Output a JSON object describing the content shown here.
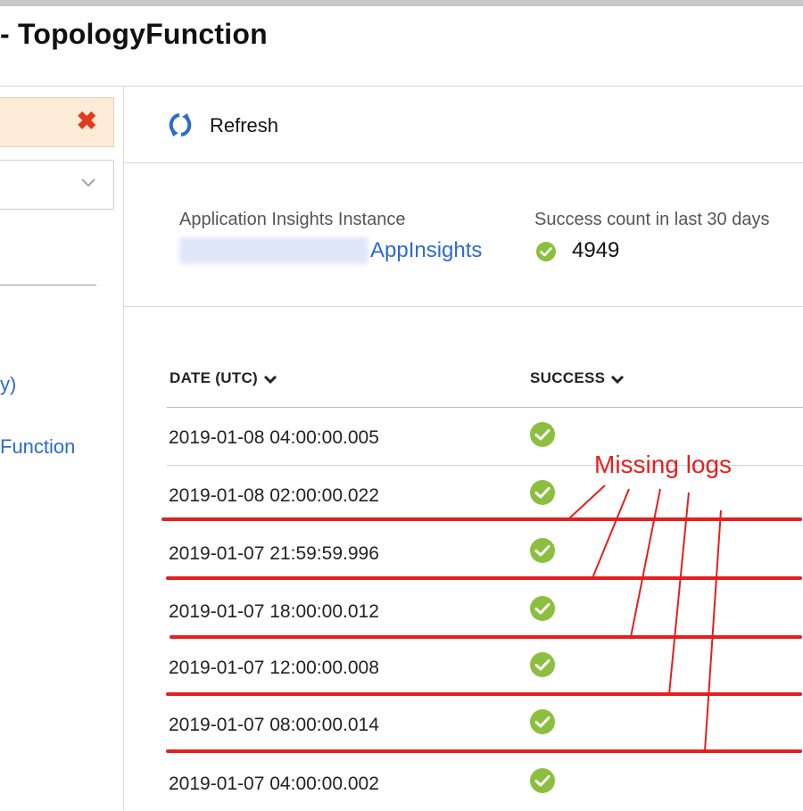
{
  "page": {
    "title": "- TopologyFunction"
  },
  "left_pane": {
    "links": [
      "y)",
      "Function"
    ]
  },
  "toolbar": {
    "refresh_label": "Refresh",
    "refresh_icon": "refresh-icon"
  },
  "info": {
    "instance_label": "Application Insights Instance",
    "instance_link": "AppInsights",
    "success_label": "Success count in last 30 days",
    "success_count": "4949"
  },
  "table": {
    "columns": [
      "DATE (UTC)",
      "SUCCESS"
    ],
    "rows": [
      {
        "date": "2019-01-08 04:00:00.005",
        "success": "check-circle-icon"
      },
      {
        "date": "2019-01-08 02:00:00.022",
        "success": "check-circle-icon"
      },
      {
        "date": "2019-01-07 21:59:59.996",
        "success": "check-circle-icon"
      },
      {
        "date": "2019-01-07 18:00:00.012",
        "success": "check-circle-icon"
      },
      {
        "date": "2019-01-07 12:00:00.008",
        "success": "check-circle-icon"
      },
      {
        "date": "2019-01-07 08:00:00.014",
        "success": "check-circle-icon"
      },
      {
        "date": "2019-01-07 04:00:00.002",
        "success": "check-circle-icon"
      }
    ]
  },
  "annotation": {
    "text": "Missing logs",
    "color": "#e61e1e"
  },
  "colors": {
    "link": "#2d6ad1",
    "success_green": "#8cbf3f",
    "error_red": "#e33a1f",
    "filter_bg": "#fbebd7"
  }
}
